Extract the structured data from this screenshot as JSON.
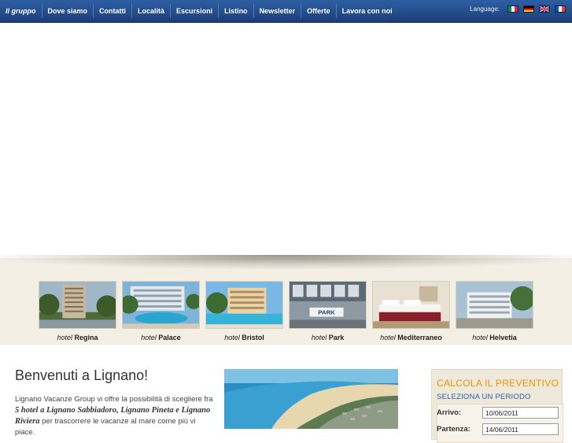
{
  "nav": {
    "items": [
      "Il gruppo",
      "Dove siamo",
      "Contatti",
      "Località",
      "Escursioni",
      "Listino",
      "Newsletter",
      "Offerte",
      "Lavora con noi"
    ],
    "language_label": "Language:",
    "flags": [
      "italian-flag-icon",
      "german-flag-icon",
      "uk-flag-icon",
      "french-flag-icon"
    ]
  },
  "hotels": [
    {
      "prefix": "hotel",
      "name": "Regina"
    },
    {
      "prefix": "hotel",
      "name": "Palace"
    },
    {
      "prefix": "hotel",
      "name": "Bristol"
    },
    {
      "prefix": "hotel",
      "name": "Park"
    },
    {
      "prefix": "hotel",
      "name": "Mediterraneo"
    },
    {
      "prefix": "hotel",
      "name": "Helvetia"
    }
  ],
  "main": {
    "title": "Benvenuti a Lignano!",
    "intro_part1": "Lignano Vacanze Group vi offre la possibilità di scegliere fra ",
    "intro_emphasis": "5 hotel a Lignano Sabbiadoro, Lignano Pineta e Lignano Riviera",
    "intro_part2": " per trascorrere le vacanze al mare come più vi piace."
  },
  "calc": {
    "title": "CALCOLA IL PREVENTIVO",
    "subtitle": "SELEZIONA UN PERIODO",
    "arrival_label": "Arrivo:",
    "arrival_value": "10/06/2011",
    "departure_label": "Partenza:",
    "departure_value": "14/06/2011"
  },
  "colors": {
    "nav_bg": "#2a579a",
    "accent_orange": "#f29300",
    "accent_blue": "#2b5fa3",
    "strip_bg": "#f3efe4"
  }
}
